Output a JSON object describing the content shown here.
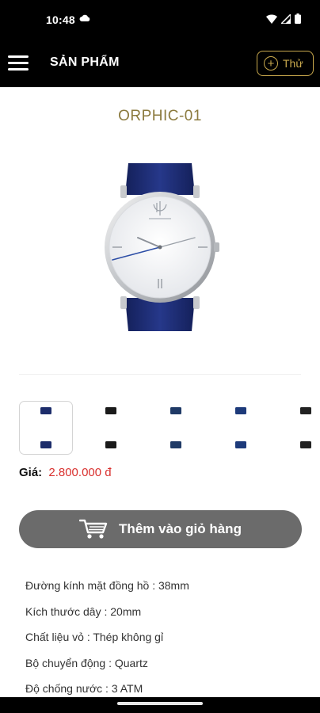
{
  "status": {
    "time": "10:48",
    "icons": [
      "cloud-icon",
      "wifi-icon",
      "signal-icon",
      "battery-icon"
    ]
  },
  "appbar": {
    "title": "SẢN PHẨM",
    "try_label": "Thử",
    "menu_icon": "menu-icon",
    "try_icon": "plus-circle-icon"
  },
  "product": {
    "name": "ORPHIC-01",
    "price_label": "Giá:",
    "price": "2.800.000 đ",
    "add_to_cart": "Thêm vào giỏ hàng",
    "thumbnails": [
      {
        "strap": "#1d2d6b",
        "selected": true
      },
      {
        "strap": "#1a1a1a",
        "selected": false
      },
      {
        "strap": "#1f3a66",
        "selected": false
      },
      {
        "strap": "#1d3a7a",
        "selected": false
      },
      {
        "strap": "#222222",
        "selected": false
      }
    ]
  },
  "specs": [
    "Đường kính mặt đồng hồ : 38mm",
    "Kích thước dây : 20mm",
    "Chất liệu vỏ : Thép không gỉ",
    "Bộ chuyển động : Quartz",
    "Độ chống nước : 3 ATM"
  ],
  "colors": {
    "accent_gold": "#c9a94d",
    "title_gold": "#8b7a3e",
    "price_red": "#d9302e",
    "button_gray": "#6b6b6b",
    "strap_navy": "#1d2d6b"
  }
}
